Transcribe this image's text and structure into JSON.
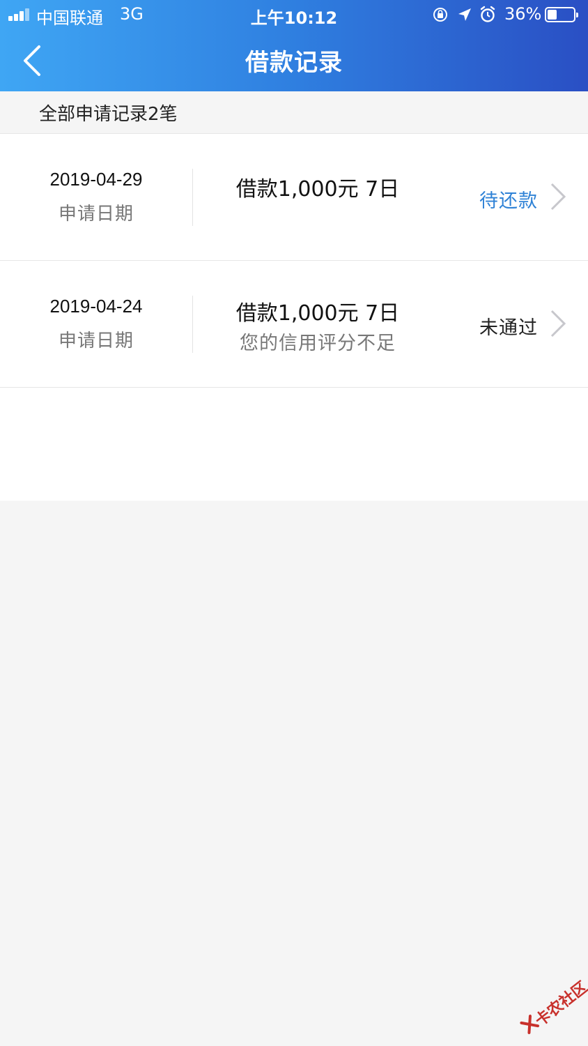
{
  "status_bar": {
    "carrier": "中国联通",
    "network": "3G",
    "time": "上午10:12",
    "battery": "36%",
    "icons": [
      "signal-icon",
      "orientation-lock-icon",
      "location-icon",
      "alarm-icon",
      "battery-icon"
    ],
    "battery_level": 0.36
  },
  "nav": {
    "back_icon": "back-chevron-icon",
    "title": "借款记录"
  },
  "summary": {
    "text": "全部申请记录2笔"
  },
  "records": [
    {
      "date": "2019-04-29",
      "date_label": "申请日期",
      "amount": "借款1,000元 7日",
      "note": "",
      "status": "待还款",
      "status_color": "#2f82d6"
    },
    {
      "date": "2019-04-24",
      "date_label": "申请日期",
      "amount": "借款1,000元 7日",
      "note": "您的信用评分不足",
      "status": "未通过",
      "status_color": "#222222"
    }
  ],
  "watermark": {
    "text": "卡农社区"
  },
  "colors": {
    "header_start": "#3fa6f4",
    "header_end": "#2a4fc4",
    "background": "#f5f5f5",
    "accent": "#2f82d6"
  }
}
